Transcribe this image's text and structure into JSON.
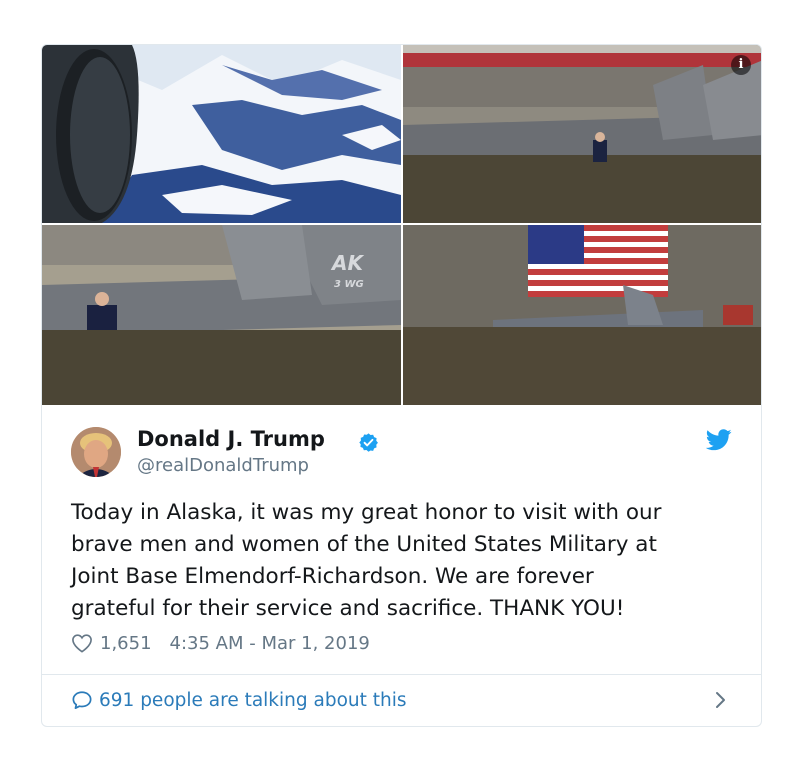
{
  "tweet": {
    "author_name": "Donald J. Trump",
    "author_handle": "@realDonaldTrump",
    "text_lines": [
      "Today in Alaska, it was my great honor to visit with our",
      "brave men and women of the United States Military at",
      "Joint Base Elmendorf-Richardson. We are forever",
      "grateful for their service and sacrifice. THANK YOU!"
    ],
    "like_count": "1,651",
    "timestamp": "4:35 AM - Mar 1, 2019",
    "talking_label": "691 people are talking about this"
  },
  "media": {
    "info_label": "i",
    "aircraft_tail_text": "AK",
    "aircraft_tail_sub": "3 WG"
  },
  "icons": {
    "verified": "verified-badge-icon",
    "platform": "twitter-bird-icon",
    "like": "heart-icon",
    "reply": "speech-bubble-icon",
    "more": "chevron-right-icon"
  },
  "colors": {
    "brand": "#1da1f2",
    "link": "#2b7bb9",
    "muted": "#657786",
    "text": "#14171a",
    "border": "#e1e8ed"
  }
}
